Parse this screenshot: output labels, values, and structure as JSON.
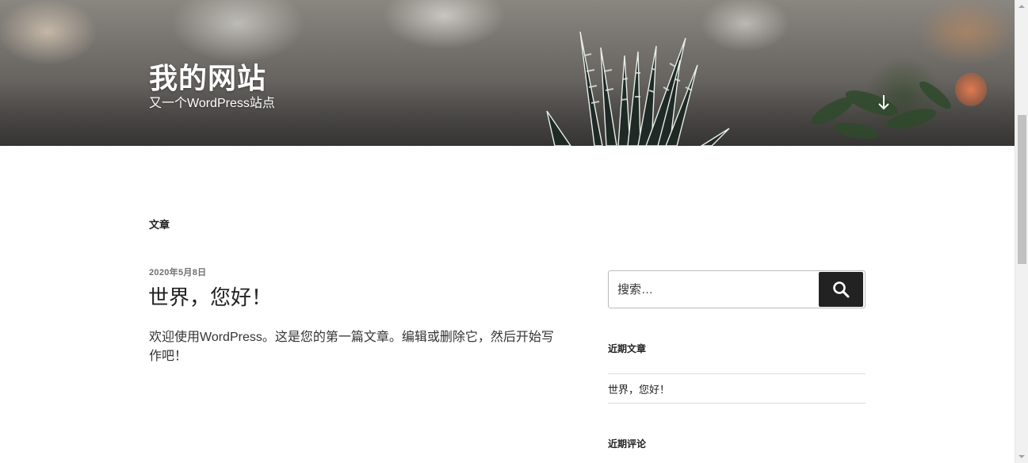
{
  "header": {
    "site_title": "我的网站",
    "site_tagline": "又一个WordPress站点"
  },
  "main": {
    "page_heading": "文章",
    "posts": [
      {
        "date": "2020年5月8日",
        "title": "世界，您好！",
        "excerpt": "欢迎使用WordPress。这是您的第一篇文章。编辑或删除它，然后开始写作吧！"
      }
    ]
  },
  "sidebar": {
    "search": {
      "placeholder": "搜索…"
    },
    "recent_posts": {
      "title": "近期文章",
      "items": [
        "世界，您好！"
      ]
    },
    "recent_comments": {
      "title": "近期评论"
    }
  },
  "icons": {
    "scroll_down": "arrow-down-icon",
    "search": "search-icon"
  },
  "colors": {
    "text": "#222222",
    "meta": "#6f6f6f",
    "search_button": "#222222",
    "rule": "#dddddd"
  }
}
